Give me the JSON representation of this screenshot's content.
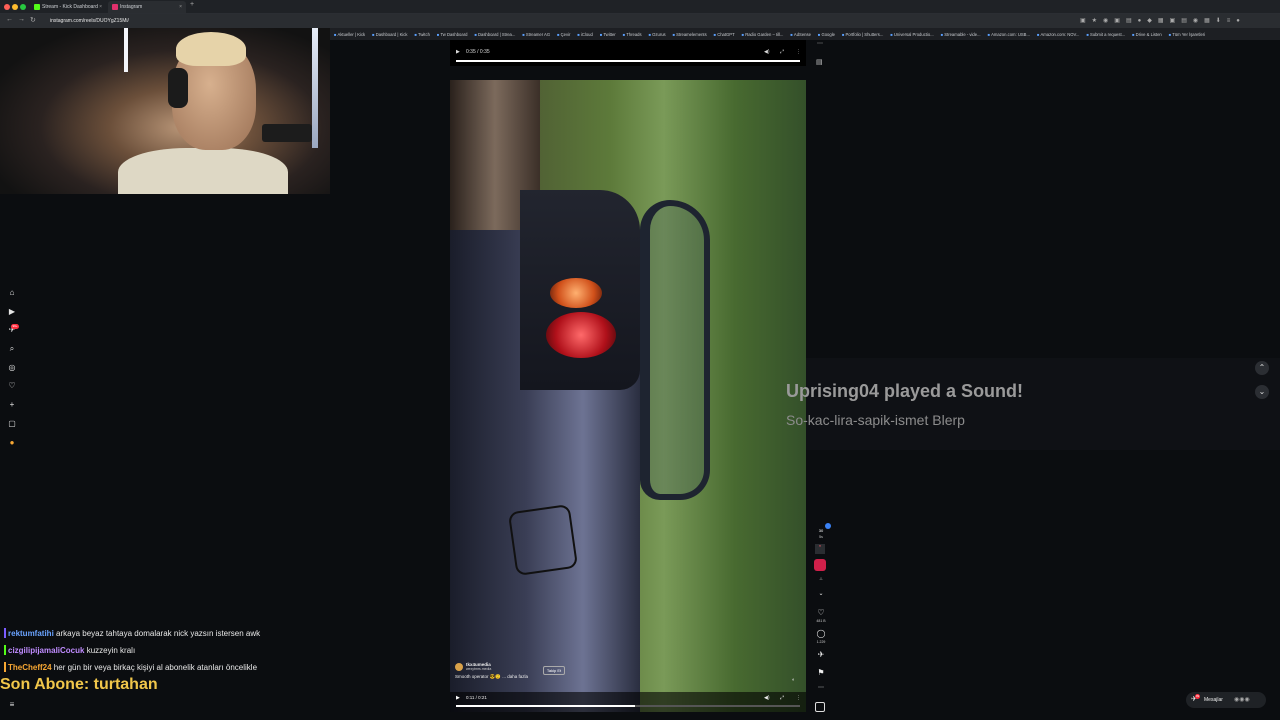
{
  "browser": {
    "tabs": [
      {
        "title": "Stream - Kick Dashboard",
        "color": "#53fc18"
      },
      {
        "title": "Instagram",
        "color": "#e1306c"
      }
    ],
    "url": "instagram.com/reels/DUOYgZ15Mi/",
    "bookmarks": [
      "Aktueller | Kick",
      "Dashboard | Kick",
      "Twitch",
      "Tw Dashboard",
      "Dashboard | Strea...",
      "Streamer AG",
      "Çevir",
      "iCloud",
      "Twitter",
      "Threads",
      "Ozurus",
      "Streamelements",
      "ChatGPT",
      "Radio Garden – Iill...",
      "AdSense",
      "Google",
      "Portfolio | Shutters...",
      "Universal Productio...",
      "Streamable - vide...",
      "Amazon.com: USB...",
      "Amazon.com: NOV...",
      "Submit a request...",
      "Drive & Listen",
      "Tüm Yer İşaretleri"
    ]
  },
  "chat": [
    {
      "user": "rektumfatihi",
      "color": "#6aa3ff",
      "bar": "#7a5cff",
      "message": "arkaya beyaz tahtaya domalarak nick yazsın istersen awk"
    },
    {
      "user": "cizgilipijamaliCocuk",
      "color": "#c08cff",
      "bar": "#53fc18",
      "message": "kuzzeyin kralı"
    },
    {
      "user": "TheCheff24",
      "color": "#f7a733",
      "bar": "#f7a733",
      "message": "her gün bir veya birkaç kişiyi al abonelik atanları öncelikle"
    }
  ],
  "last_sub": "Son Abone: turtahan",
  "reel": {
    "top_time": "0:35 / 0:35",
    "bottom_time": "0:11 / 0:21",
    "bottom_progress": 0.52,
    "author": "tkx4umedia",
    "sub_author": "wexytmrs.media",
    "caption": "Smooth operator 😎🙂 ... daha fazla",
    "follow": "Takip Et",
    "likes": "481 B",
    "comments": "1.229",
    "side_top_count": "30",
    "side_top_sub": "5s"
  },
  "alert": {
    "title": "Uprising04 played a Sound!",
    "subtitle": "So-kac-lira-sapik-ismet Blerp"
  },
  "messages": {
    "label": "Mesajlar",
    "badge": "99"
  },
  "sidebar_badge": "99+"
}
